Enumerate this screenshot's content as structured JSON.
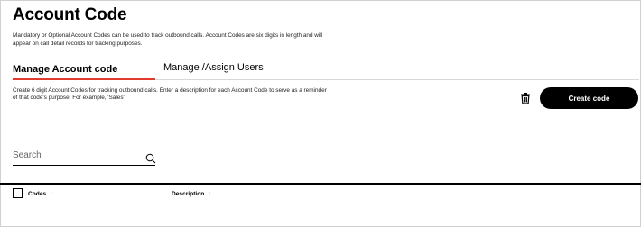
{
  "header": {
    "title": "Account Code",
    "description": "Mandatory or Optional Account Codes can be used to track outbound calls. Account Codes are six digits in length and will appear on call detail records for tracking purposes."
  },
  "tabs": [
    {
      "label": "Manage Account code",
      "active": true
    },
    {
      "label": "Manage /Assign Users",
      "active": false
    }
  ],
  "section": {
    "description": "Create 6 digit Account Codes for tracking outbound calls. Enter a description for each Account Code to serve as a reminder of that code's purpose. For example, 'Sales'."
  },
  "actions": {
    "delete_icon": "trash-icon",
    "create_label": "Create code"
  },
  "search": {
    "placeholder": "Search",
    "value": "",
    "icon": "search-icon"
  },
  "table": {
    "columns": [
      {
        "label": "Codes",
        "sort_icon": "↕"
      },
      {
        "label": "Description",
        "sort_icon": "↕"
      }
    ],
    "rows": []
  },
  "colors": {
    "accent": "#e23b2e",
    "primary_button": "#000000"
  }
}
